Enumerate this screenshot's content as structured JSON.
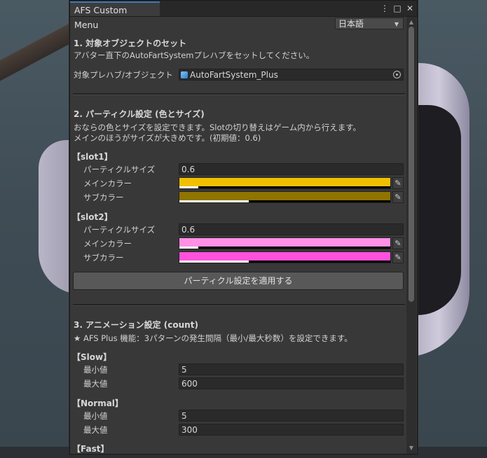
{
  "window": {
    "tab_title": "AFS Custom Menu",
    "more_icon": "more-vertical-icon",
    "maximize_icon": "maximize-icon",
    "close_icon": "close-icon",
    "language": "日本語"
  },
  "section1": {
    "heading": "1. 対象オブジェクトのセット",
    "desc": "アバター直下のAutoFartSystemプレハブをセットしてください。",
    "field_label": "対象プレハブ/オブジェクト",
    "field_value": "AutoFartSystem_Plus"
  },
  "section2": {
    "heading": "2. パーティクル設定 (色とサイズ)",
    "desc1": "おならの色とサイズを設定できます。Slotの切り替えはゲーム内から行えます。",
    "desc2": "メインのほうがサイズが大きめです。(初期値：0.6)",
    "slots": [
      {
        "label": "【slot1】",
        "size_label": "パーティクルサイズ",
        "size_value": "0.6",
        "main_label": "メインカラー",
        "main_color": "#f0c000",
        "main_alpha": 0.09,
        "sub_label": "サブカラー",
        "sub_color": "#8f7400",
        "sub_alpha": 0.33
      },
      {
        "label": "【slot2】",
        "size_label": "パーティクルサイズ",
        "size_value": "0.6",
        "main_label": "メインカラー",
        "main_color": "#ff90e6",
        "main_alpha": 0.09,
        "sub_label": "サブカラー",
        "sub_color": "#ff52dc",
        "sub_alpha": 0.33
      }
    ],
    "apply_button": "パーティクル設定を適用する"
  },
  "section3": {
    "heading": "3. アニメーション設定 (count)",
    "desc": "★ AFS Plus 機能：3パターンの発生間隔（最小/最大秒数）を設定できます。",
    "groups": [
      {
        "label": "【Slow】",
        "min_label": "最小値",
        "min_value": "5",
        "max_label": "最大値",
        "max_value": "600"
      },
      {
        "label": "【Normal】",
        "min_label": "最小値",
        "min_value": "5",
        "max_label": "最大値",
        "max_value": "300"
      },
      {
        "label": "【Fast】"
      }
    ]
  }
}
